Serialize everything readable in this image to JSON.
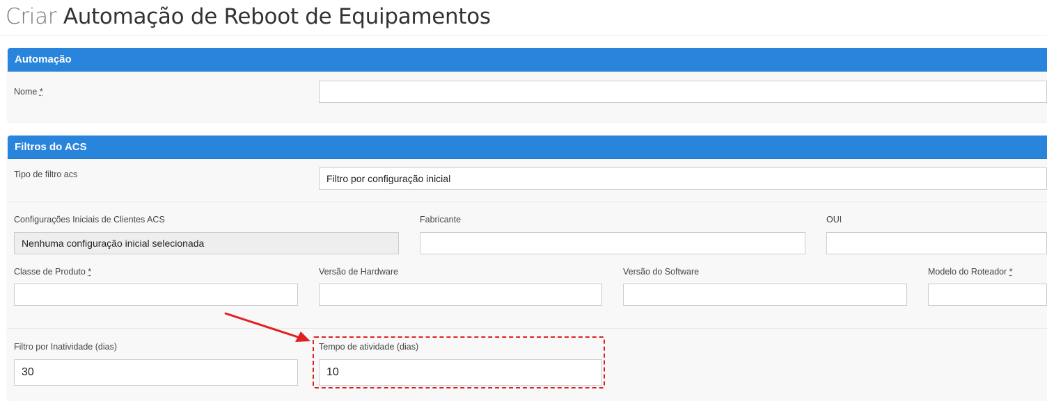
{
  "page": {
    "title_prefix": "Criar",
    "title_main": "Automação de Reboot de Equipamentos"
  },
  "automacao": {
    "heading": "Automação",
    "nome_label": "Nome",
    "required_mark": "*",
    "nome_value": ""
  },
  "filtros": {
    "heading": "Filtros do ACS",
    "tipo_label": "Tipo de filtro acs",
    "tipo_value": "Filtro por configuração inicial",
    "config_label": "Configurações Iniciais de Clientes ACS",
    "config_value": "Nenhuma configuração inicial selecionada",
    "fabricante_label": "Fabricante",
    "fabricante_value": "",
    "oui_label": "OUI",
    "oui_value": "",
    "classe_label": "Classe de Produto",
    "classe_value": "",
    "hardware_label": "Versão de Hardware",
    "hardware_value": "",
    "software_label": "Versão do Software",
    "software_value": "",
    "modelo_label": "Modelo do Roteador",
    "modelo_value": "",
    "inatividade_label": "Filtro por Inatividade (dias)",
    "inatividade_value": "30",
    "atividade_label": "Tempo de atividade (dias)",
    "atividade_value": "10"
  },
  "colors": {
    "panel_header": "#2984db",
    "annotation": "#e02020"
  }
}
